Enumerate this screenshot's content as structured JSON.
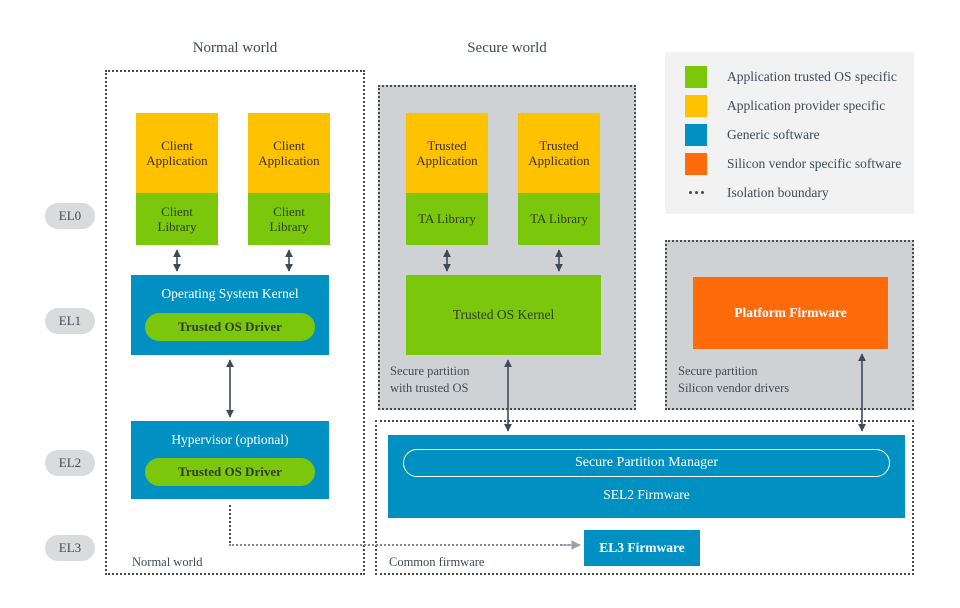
{
  "columns": {
    "normal_world_header": "Normal world",
    "secure_world_header": "Secure world"
  },
  "exception_levels": [
    {
      "id": "el0",
      "label": "EL0"
    },
    {
      "id": "el1",
      "label": "EL1"
    },
    {
      "id": "el2",
      "label": "EL2"
    },
    {
      "id": "el3",
      "label": "EL3"
    }
  ],
  "normal_world": {
    "bottom_label": "Normal world",
    "apps": [
      {
        "application": "Client\nApplication",
        "library": "Client\nLibrary"
      },
      {
        "application": "Client\nApplication",
        "library": "Client\nLibrary"
      }
    ],
    "kernel": {
      "title": "Operating System Kernel",
      "driver": "Trusted OS Driver"
    },
    "hypervisor": {
      "title": "Hypervisor (optional)",
      "driver": "Trusted OS Driver"
    }
  },
  "secure_world": {
    "partition_caption": "Secure partition\nwith trusted OS",
    "apps": [
      {
        "application": "Trusted\nApplication",
        "library": "TA Library"
      },
      {
        "application": "Trusted\nApplication",
        "library": "TA Library"
      }
    ],
    "trusted_os_kernel": "Trusted OS Kernel"
  },
  "silicon_partition": {
    "partition_caption": "Secure partition\nSilicon vendor drivers",
    "platform_firmware": "Platform Firmware"
  },
  "common_firmware": {
    "bottom_label": "Common firmware",
    "secure_partition_manager": "Secure Partition Manager",
    "sel2_firmware": "SEL2 Firmware",
    "el3_firmware": "EL3 Firmware"
  },
  "legend": {
    "items": [
      {
        "color": "#7ac70c",
        "label": "Application trusted OS specific",
        "swatch": "color"
      },
      {
        "color": "#ffc200",
        "label": "Application provider specific",
        "swatch": "color"
      },
      {
        "color": "#0091c2",
        "label": "Generic software",
        "swatch": "color"
      },
      {
        "color": "#ff6b0b",
        "label": "Silicon vendor specific software",
        "swatch": "color"
      },
      {
        "color": "#4a4a4a",
        "label": "Isolation boundary",
        "swatch": "dots"
      }
    ]
  },
  "palette": {
    "green": "#7ac70c",
    "yellow": "#ffc200",
    "blue": "#0091c2",
    "orange": "#ff6b0b",
    "gray_partition": "#cfd2d4",
    "legend_bg": "#f2f2f2",
    "boundary": "#4a4a4a",
    "text": "#3d4b57"
  }
}
